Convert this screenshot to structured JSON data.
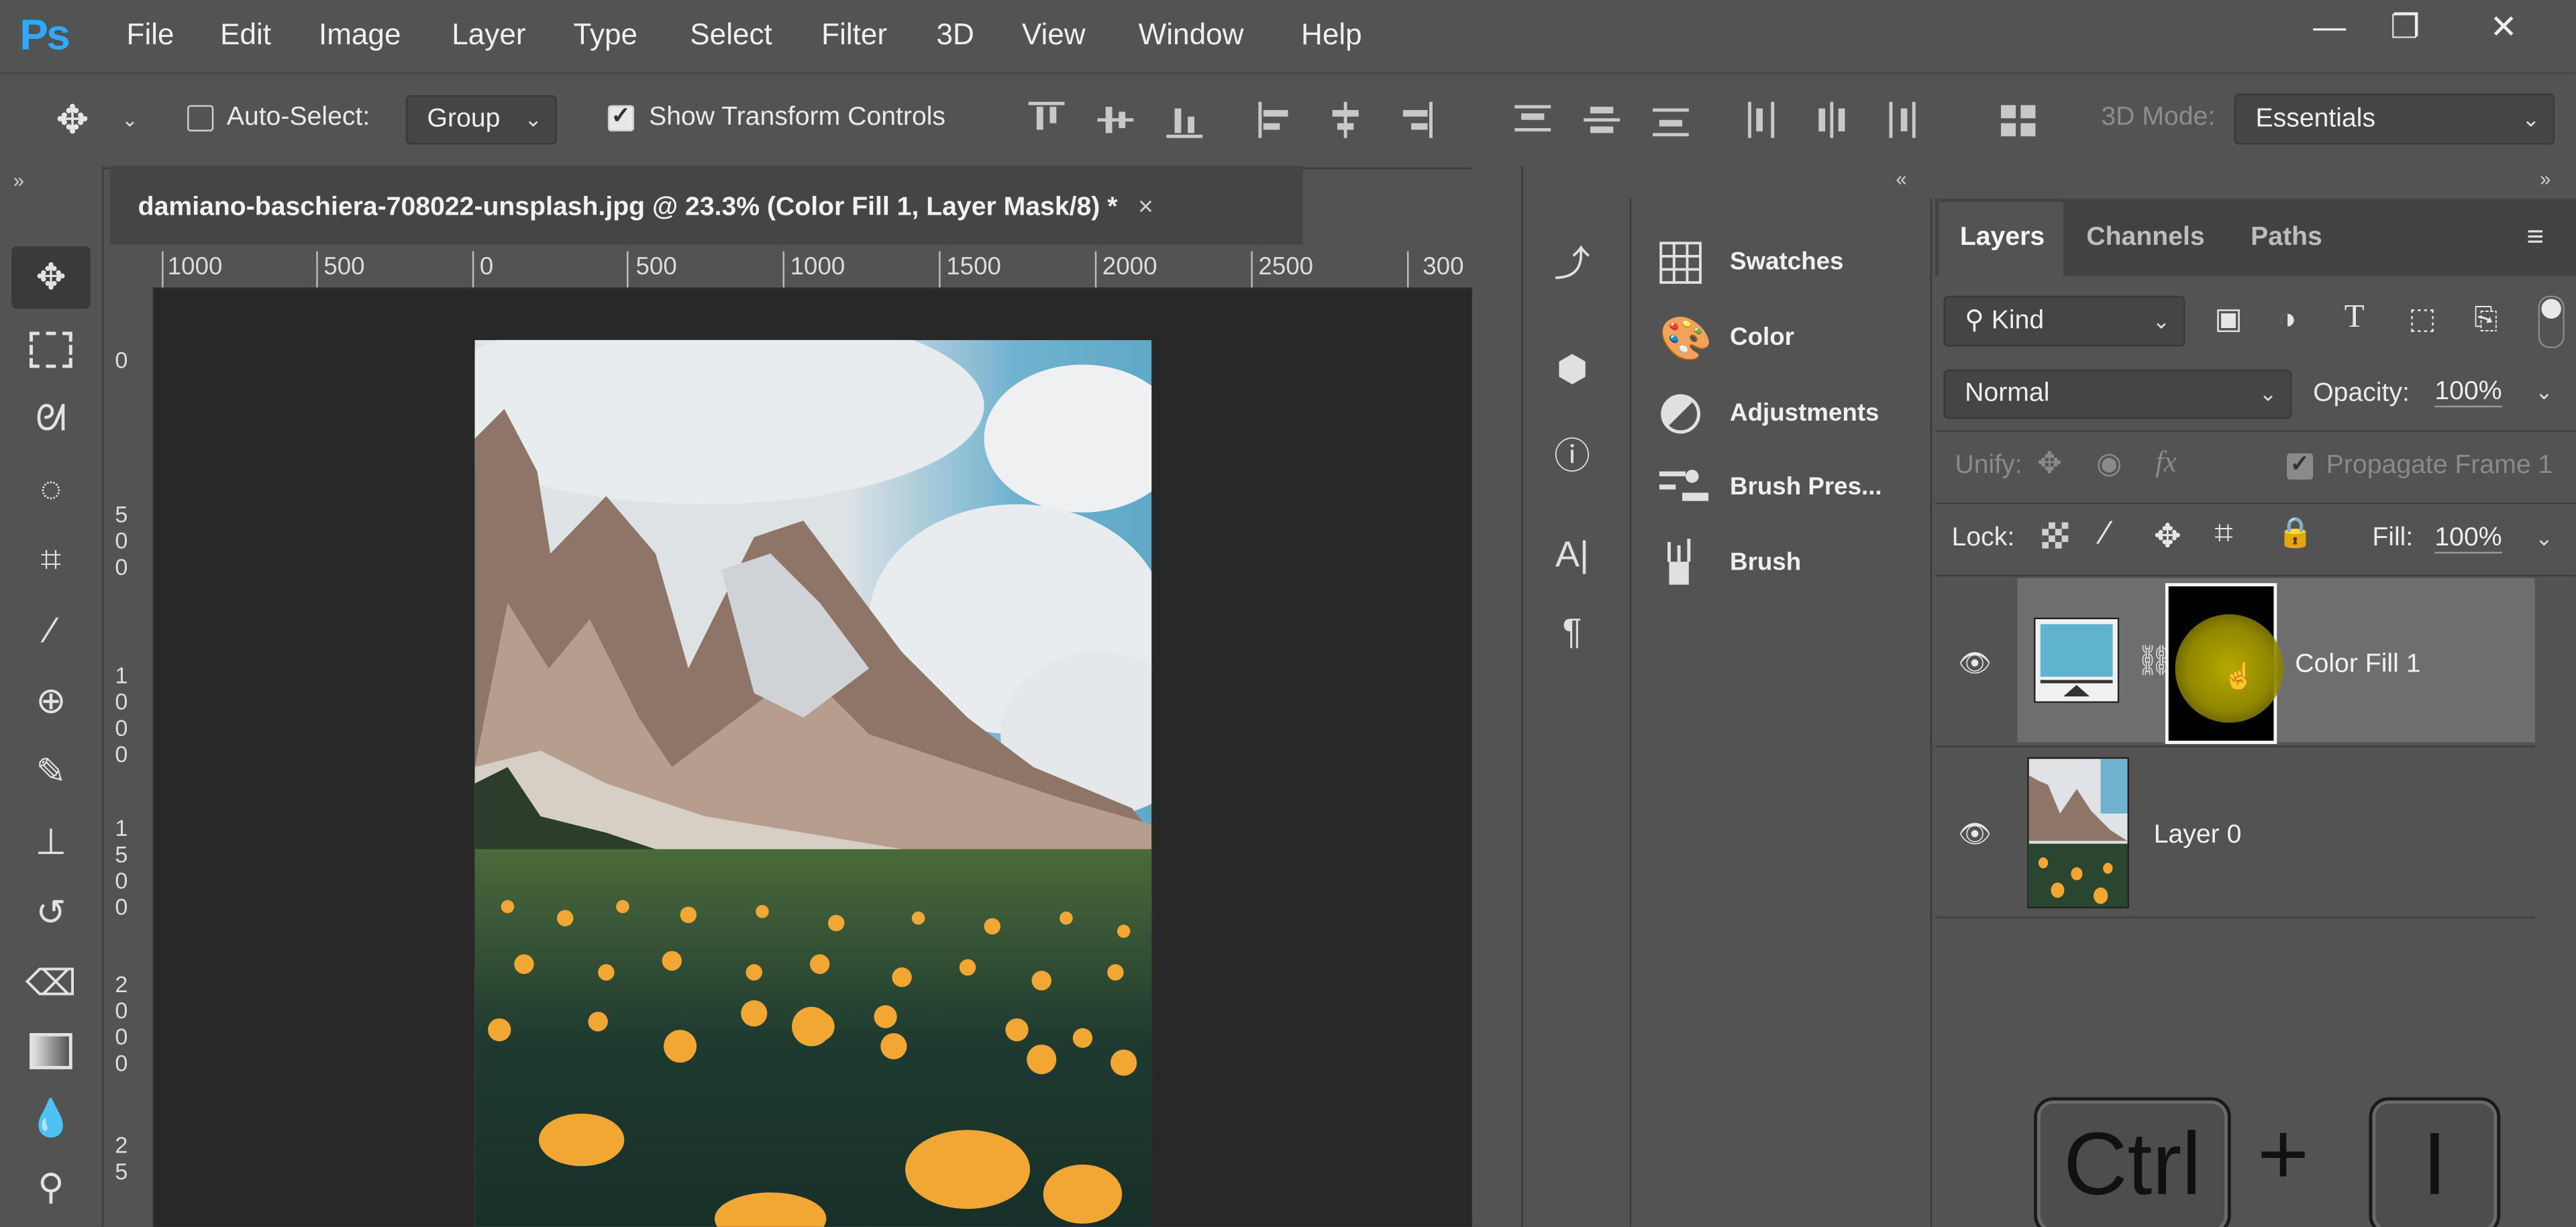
{
  "app": {
    "logo": "Ps"
  },
  "menu": [
    "File",
    "Edit",
    "Image",
    "Layer",
    "Type",
    "Select",
    "Filter",
    "3D",
    "View",
    "Window",
    "Help"
  ],
  "window_controls": {
    "minimize": "—",
    "restore": "❐",
    "close": "✕"
  },
  "options_bar": {
    "auto_select_label": "Auto-Select:",
    "auto_select_checked": false,
    "auto_select_target": "Group",
    "show_transform_label": "Show Transform Controls",
    "show_transform_checked": true,
    "mode_3d_label": "3D Mode:",
    "workspace": "Essentials"
  },
  "document": {
    "tab_title": "damiano-baschiera-708022-unsplash.jpg @ 23.3% (Color Fill 1, Layer Mask/8) *",
    "close_glyph": "×",
    "ruler_h": [
      "1000",
      "500",
      "0",
      "500",
      "1000",
      "1500",
      "2000",
      "2500",
      "300"
    ],
    "ruler_v": [
      [
        "0"
      ],
      [
        "5",
        "0",
        "0"
      ],
      [
        "1",
        "0",
        "0",
        "0"
      ],
      [
        "1",
        "5",
        "0",
        "0"
      ],
      [
        "2",
        "0",
        "0",
        "0"
      ],
      [
        "2",
        "5"
      ]
    ]
  },
  "mid_panel": {
    "items": [
      {
        "label": "Swatches",
        "icon": "grid-icon"
      },
      {
        "label": "Color",
        "icon": "palette-icon"
      },
      {
        "label": "Adjustments",
        "icon": "half-circle-icon"
      },
      {
        "label": "Brush Pres...",
        "icon": "brush-presets-icon"
      },
      {
        "label": "Brush",
        "icon": "brush-icon"
      }
    ]
  },
  "layers_panel": {
    "tabs": [
      "Layers",
      "Channels",
      "Paths"
    ],
    "active_tab": "Layers",
    "filter_kind": "Kind",
    "blend_mode": "Normal",
    "opacity_label": "Opacity:",
    "opacity": "100%",
    "unify_label": "Unify:",
    "propagate_label": "Propagate Frame 1",
    "lock_label": "Lock:",
    "fill_label": "Fill:",
    "fill": "100%",
    "layers": [
      {
        "name": "Color Fill 1",
        "visible": true,
        "selected": true,
        "fill_color": "#5fb3cf"
      },
      {
        "name": "Layer 0",
        "visible": true,
        "selected": false
      }
    ]
  },
  "shortcut_overlay": {
    "key1": "Ctrl",
    "plus": "+",
    "key2": "I"
  },
  "colors": {
    "ps_blue": "#31a8ff",
    "canvas_bg": "#282828",
    "ui_bg": "#535353"
  }
}
